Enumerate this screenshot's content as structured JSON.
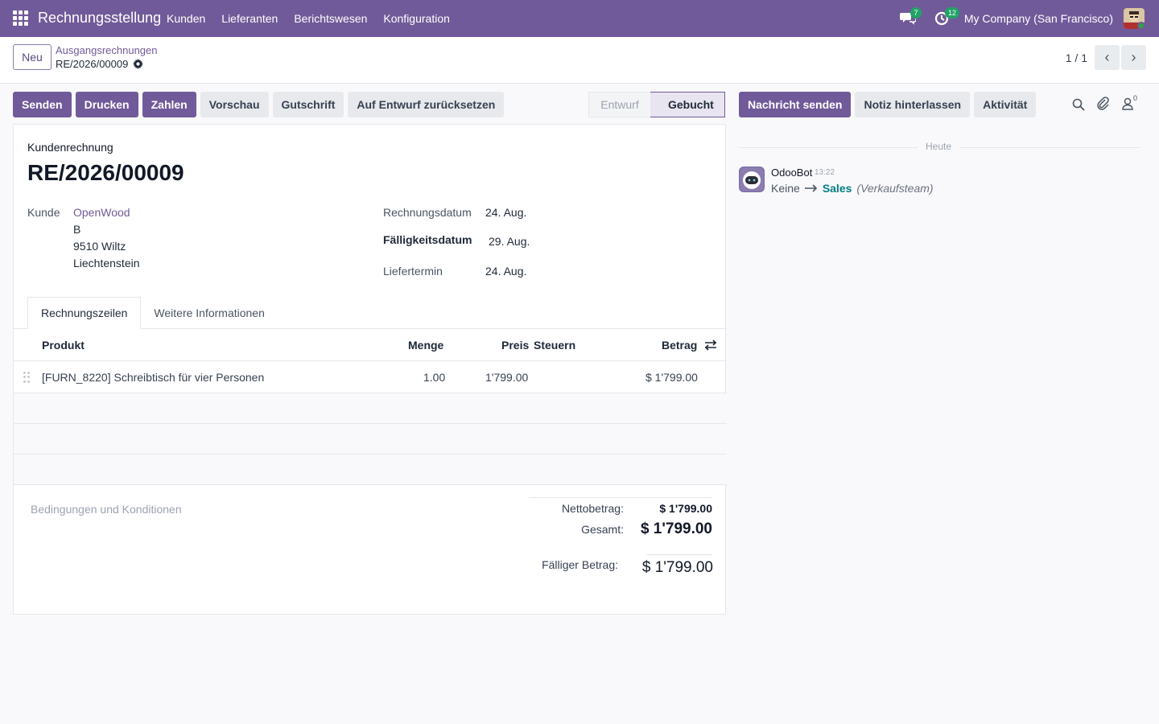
{
  "navbar": {
    "app_title": "Rechnungsstellung",
    "menu": [
      "Kunden",
      "Lieferanten",
      "Berichtswesen",
      "Konfiguration"
    ],
    "messages_badge": "7",
    "activities_badge": "12",
    "company": "My Company (San Francisco)"
  },
  "control_panel": {
    "new_button": "Neu",
    "breadcrumb_parent": "Ausgangsrechnungen",
    "breadcrumb_current": "RE/2026/00009",
    "pager": "1 / 1"
  },
  "actions": {
    "send": "Senden",
    "print": "Drucken",
    "pay": "Zahlen",
    "preview": "Vorschau",
    "credit_note": "Gutschrift",
    "reset_draft": "Auf Entwurf zurücksetzen"
  },
  "status": {
    "draft": "Entwurf",
    "posted": "Gebucht"
  },
  "invoice": {
    "move_type": "Kundenrechnung",
    "name": "RE/2026/00009",
    "customer_label": "Kunde",
    "customer_name": "OpenWood",
    "customer_addr_1": "B",
    "customer_addr_2": "9510 Wiltz",
    "customer_addr_3": "Liechtenstein",
    "invoice_date_label": "Rechnungsdatum",
    "invoice_date": "24. Aug.",
    "due_date_label": "Fälligkeitsdatum",
    "due_date": "29. Aug.",
    "delivery_date_label": "Liefertermin",
    "delivery_date": "24. Aug."
  },
  "tabs": {
    "lines": "Rechnungszeilen",
    "other": "Weitere Informationen"
  },
  "table": {
    "headers": {
      "product": "Produkt",
      "quantity": "Menge",
      "price": "Preis",
      "taxes": "Steuern",
      "amount": "Betrag"
    },
    "rows": [
      {
        "product": "[FURN_8220] Schreibtisch für vier Personen",
        "quantity": "1.00",
        "price": "1'799.00",
        "taxes": "",
        "amount": "$ 1'799.00"
      }
    ]
  },
  "totals": {
    "terms_placeholder": "Bedingungen und Konditionen",
    "untaxed_label": "Nettobetrag:",
    "untaxed_value": "$ 1'799.00",
    "total_label": "Gesamt:",
    "total_value": "$ 1'799.00",
    "residual_label": "Fälliger Betrag:",
    "residual_value": "$ 1'799.00"
  },
  "chatter": {
    "send_message": "Nachricht senden",
    "log_note": "Notiz hinterlassen",
    "activity": "Aktivität",
    "followers_count": "0",
    "date_separator": "Heute",
    "messages": [
      {
        "author": "OdooBot",
        "time": "13:22",
        "old_value": "Keine",
        "new_value": "Sales",
        "field": "(Verkaufsteam)"
      }
    ]
  },
  "colors": {
    "brand": "#715a99",
    "badge": "#21a366",
    "teal": "#017e84"
  }
}
